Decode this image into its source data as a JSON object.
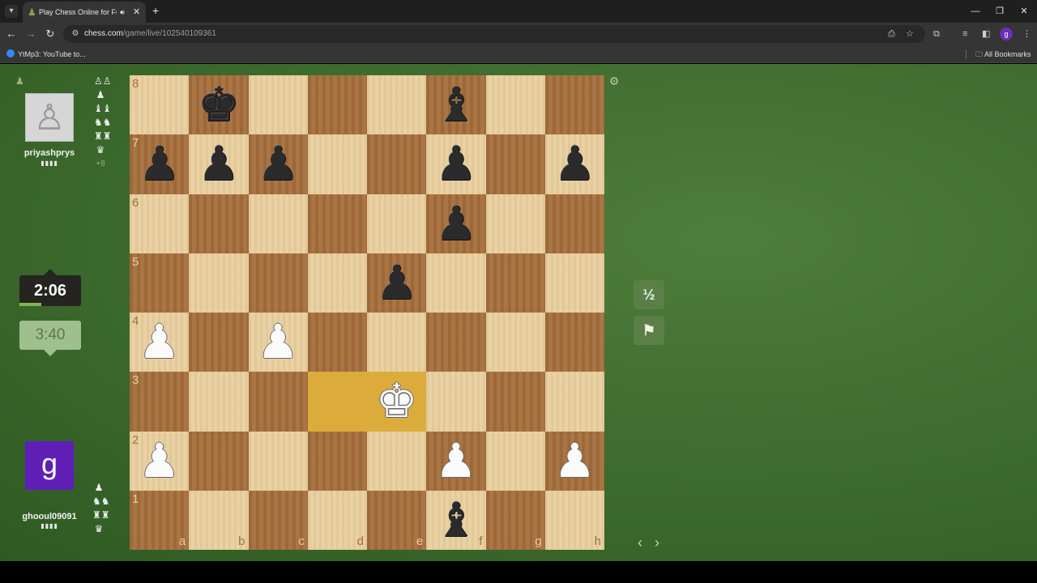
{
  "browser": {
    "tab_title": "Play Chess Online for Free",
    "url_host": "chess.com",
    "url_path": "/game/live/102540109361",
    "bookmark_label": "YtMp3: YouTube to...",
    "all_bookmarks_label": "All Bookmarks",
    "profile_initial": "g",
    "icons": {
      "tab_list": "chevron-down-icon",
      "favicon": "chess-pawn-icon",
      "audio": "speaker-icon",
      "close": "close-icon",
      "new_tab": "plus-icon",
      "minimize": "minimize-icon",
      "restore": "restore-icon",
      "window_close": "close-icon",
      "back": "back-arrow-icon",
      "forward": "forward-arrow-icon",
      "reload": "reload-icon",
      "site_info": "tune-icon",
      "install": "install-icon",
      "star": "star-icon",
      "extensions": "puzzle-icon",
      "media": "media-control-icon",
      "sidepanel": "side-panel-icon",
      "menu": "kebab-menu-icon",
      "folder": "folder-icon"
    }
  },
  "game": {
    "top_player": {
      "name": "priyashprys",
      "rating_marks": "▮▮▮▮",
      "captured": [
        "♙♙",
        "♟",
        "♝♝",
        "♞♞",
        "♜♜",
        "♛"
      ],
      "advantage": "+8"
    },
    "bottom_player": {
      "name": "ghooul09091",
      "avatar_letter": "g",
      "rating_marks": "▮▮▮▮",
      "captured": [
        "♟",
        "♞♞",
        "♜♜",
        "♛"
      ]
    },
    "clocks": {
      "active": "2:06",
      "idle": "3:40",
      "active_fraction_remaining": 0.35
    },
    "controls": {
      "draw_label": "½",
      "resign_icon": "flag-icon",
      "prev_icon": "chevron-left-icon",
      "next_icon": "chevron-right-icon",
      "settings_icon": "gear-icon"
    },
    "board": {
      "ranks": [
        "8",
        "7",
        "6",
        "5",
        "4",
        "3",
        "2",
        "1"
      ],
      "files": [
        "a",
        "b",
        "c",
        "d",
        "e",
        "f",
        "g",
        "h"
      ],
      "highlighted": [
        "d3",
        "e3"
      ],
      "pieces": {
        "b8": {
          "glyph": "♚",
          "color": "black",
          "name": "black-king"
        },
        "f8": {
          "glyph": "♝",
          "color": "black",
          "name": "black-bishop"
        },
        "a7": {
          "glyph": "♟",
          "color": "black",
          "name": "black-pawn"
        },
        "b7": {
          "glyph": "♟",
          "color": "black",
          "name": "black-pawn"
        },
        "c7": {
          "glyph": "♟",
          "color": "black",
          "name": "black-pawn"
        },
        "f7": {
          "glyph": "♟",
          "color": "black",
          "name": "black-pawn"
        },
        "h7": {
          "glyph": "♟",
          "color": "black",
          "name": "black-pawn"
        },
        "f6": {
          "glyph": "♟",
          "color": "black",
          "name": "black-pawn"
        },
        "e5": {
          "glyph": "♟",
          "color": "black",
          "name": "black-pawn"
        },
        "a4": {
          "glyph": "♟",
          "color": "white",
          "name": "white-pawn"
        },
        "c4": {
          "glyph": "♟",
          "color": "white",
          "name": "white-pawn"
        },
        "e3": {
          "glyph": "♚",
          "color": "white",
          "name": "white-king"
        },
        "a2": {
          "glyph": "♟",
          "color": "white",
          "name": "white-pawn"
        },
        "f2": {
          "glyph": "♟",
          "color": "white",
          "name": "white-pawn"
        },
        "h2": {
          "glyph": "♟",
          "color": "white",
          "name": "white-pawn"
        },
        "f1": {
          "glyph": "♝",
          "color": "black",
          "name": "black-bishop"
        }
      }
    }
  }
}
